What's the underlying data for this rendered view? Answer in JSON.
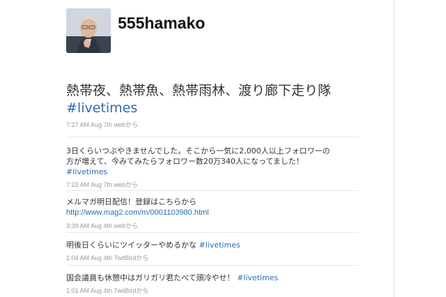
{
  "profile": {
    "screen_name": "555hamako"
  },
  "featured_tweet": {
    "text": "熱帯夜、熱帯魚、熱帯雨林、渡り廊下走り隊",
    "hashtag": "#livetimes",
    "time": "7:27 AM Aug 7th",
    "source": "web",
    "source_suffix": "から"
  },
  "tweets": [
    {
      "line1": "3日くらいつぶやきませんでした。そこから一気に2,000人以上フォロワーの",
      "line2": "方が増えて、今みてみたらフォロワー数20万340人になってました！",
      "hashtag": "#livetimes",
      "time": "7:23 AM Aug 7th",
      "source": "web",
      "source_suffix": "から"
    },
    {
      "line1": "メルマガ明日配信！登録はこちらから",
      "url": "http://www.mag2.com/m/0001103980.html",
      "time": "3:39 AM Aug 4th",
      "source": "web",
      "source_suffix": "から"
    },
    {
      "line1": "明後日くらいにツイッターやめるかな",
      "hashtag": "#livetimes",
      "time": "1:04 AM Aug 4th",
      "source": "TwitBird",
      "source_suffix": "から"
    },
    {
      "line1": "国会議員も休憩中はガリガリ君たべて頭冷やせ！",
      "hashtag": "#livetimes",
      "time": "1:01 AM Aug 4th",
      "source": "TwitBird",
      "source_suffix": "から"
    }
  ]
}
